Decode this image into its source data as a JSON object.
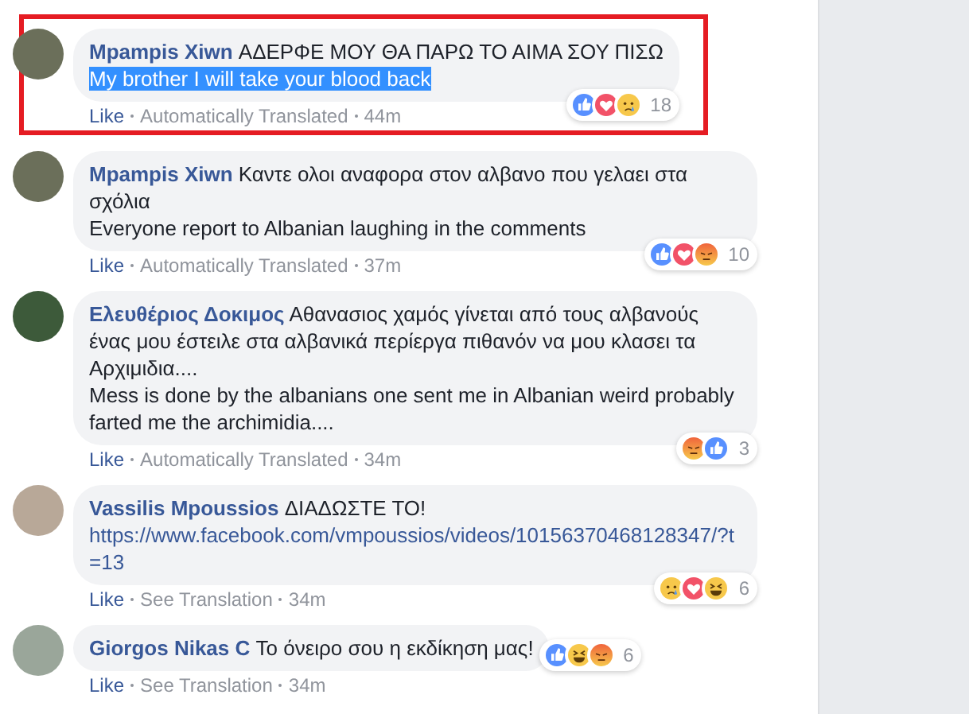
{
  "comments": [
    {
      "author": "Mpampis Xiwn",
      "text": "ΑΔΕΡΦΕ ΜΟΥ ΘΑ ΠΑΡΩ ΤΟ ΑΙΜΑ ΣΟΥ ΠΙΣΩ",
      "translation": {
        "text": "My brother I will take your blood back",
        "selected": true
      },
      "highlighted": true,
      "reactions": [
        {
          "kind": "like"
        },
        {
          "kind": "love"
        },
        {
          "kind": "sad"
        }
      ],
      "reaction_count": "18",
      "actions": [
        "Like",
        "Automatically Translated"
      ],
      "time": "44m"
    },
    {
      "author": "Mpampis Xiwn",
      "text": "Καντε ολοι αναφορα στον αλβανο που γελαει στα σχόλια",
      "translation": {
        "text": "Everyone report to Albanian laughing in the comments",
        "selected": false
      },
      "highlighted": false,
      "reactions": [
        {
          "kind": "like"
        },
        {
          "kind": "love"
        },
        {
          "kind": "angry"
        }
      ],
      "reaction_count": "10",
      "actions": [
        "Like",
        "Automatically Translated"
      ],
      "time": "37m"
    },
    {
      "author": "Ελευθέριος Δοκιμος",
      "text": "Αθανασιος χαμός γίνεται από τους αλβανούς ένας μου έστειλε στα αλβανικά περίεργα πιθανόν να μου κλασει τα Αρχιμιδια....",
      "translation": {
        "text": "Mess is done by the albanians one sent me in Albanian weird probably farted me the archimidia....",
        "selected": false
      },
      "highlighted": false,
      "reactions": [
        {
          "kind": "angry"
        },
        {
          "kind": "like"
        }
      ],
      "reaction_count": "3",
      "actions": [
        "Like",
        "Automatically Translated"
      ],
      "time": "34m"
    },
    {
      "author": "Vassilis Mpoussios",
      "text": "ΔΙΑΔΩΣΤΕ ΤΟ!",
      "link": "https://www.facebook.com/vmpoussios/videos/10156370468128347/?t=13",
      "highlighted": false,
      "reactions": [
        {
          "kind": "sad"
        },
        {
          "kind": "love"
        },
        {
          "kind": "haha"
        }
      ],
      "reaction_count": "6",
      "actions": [
        "Like",
        "See Translation"
      ],
      "time": "34m"
    },
    {
      "author": "Giorgos Nikas C",
      "text": "Το όνειρο σου η εκδίκηση μας!",
      "highlighted": false,
      "reactions": [
        {
          "kind": "like"
        },
        {
          "kind": "haha"
        },
        {
          "kind": "angry"
        }
      ],
      "reaction_count": "6",
      "actions": [
        "Like",
        "See Translation"
      ],
      "time": "34m"
    }
  ]
}
